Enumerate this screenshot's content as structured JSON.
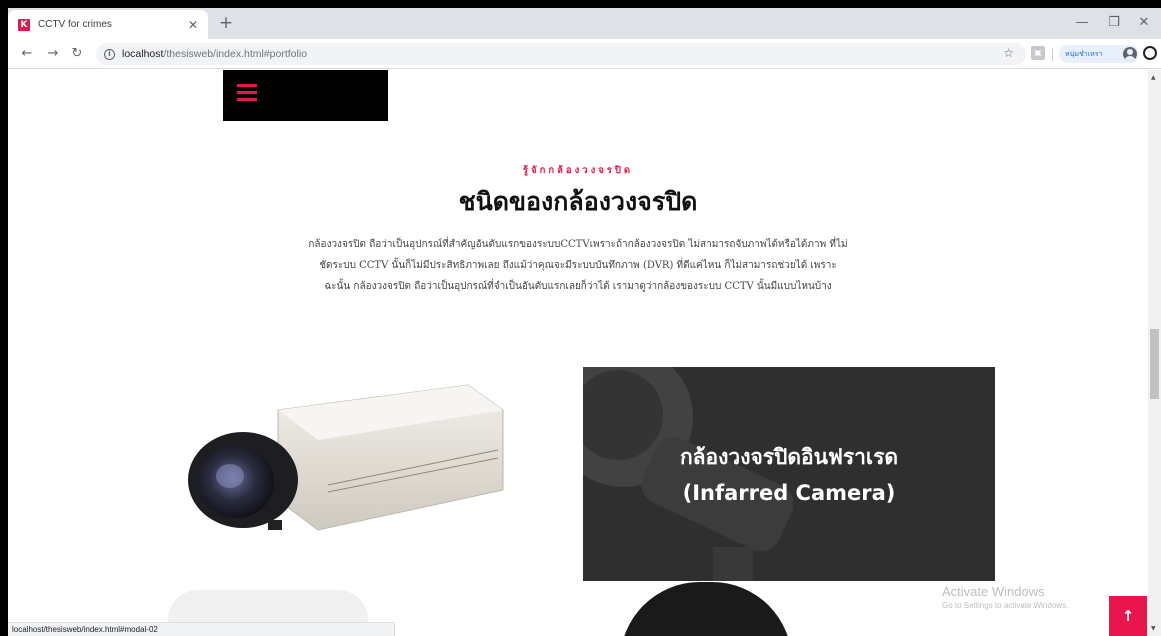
{
  "browser": {
    "tab_title": "CCTV for crimes",
    "favicon_letter": "K",
    "new_tab": "+",
    "url_host": "localhost",
    "url_path": "/thesisweb/index.html#portfolio",
    "profile_name": "หนุ่มชำเหรา",
    "status_url": "localhost/thesisweb/index.html#modal-02"
  },
  "section": {
    "subtitle": "รู้จักกล้องวงจรปิด",
    "heading": "ชนิดของกล้องวงจรปิด",
    "description": "กล้องวงจรปิด ถือว่าเป็นอุปกรณ์ที่สำคัญอันดับแรกของระบบCCTVเพราะถ้ากล้องวงจรปิด ไม่สามารถจับภาพได้หรือได้ภาพ ที่ไม่ชัดระบบ CCTV นั้นก็ไม่มีประสิทธิภาพเลย ถึงแม้ว่าคุณจะมีระบบบันทึกภาพ (DVR) ที่ดีแค่ไหน ก็ไม่สามารถช่วยได้ เพราะฉะนั้น กล้องวงจรปิด ถือว่าเป็นอุปกรณ์ที่จำเป็นอันดับแรกเลยก็ว่าได้ เรามาดูว่ากล้องของระบบ CCTV นั้นมีแบบไหนบ้าง"
  },
  "portfolio": {
    "infrared_title_line1": "กล้องวงจรปิดอินฟราเรด",
    "infrared_title_line2": "(Infarred Camera)"
  },
  "watermark": {
    "line1": "Activate Windows",
    "line2": "Go to Settings to activate Windows."
  },
  "scroll_top_label": "↑",
  "colors": {
    "accent": "#e8164c",
    "card_bg": "#2f2f2f"
  }
}
